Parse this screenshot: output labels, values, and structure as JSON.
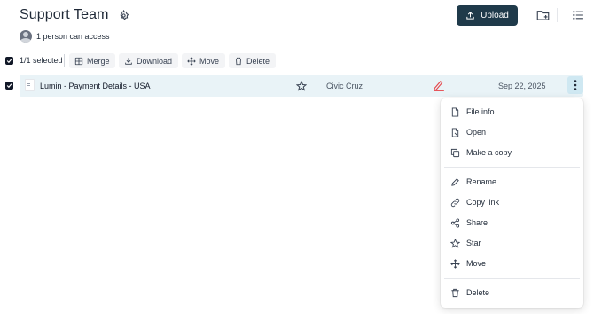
{
  "header": {
    "title": "Support Team",
    "access_text": "1 person can access",
    "upload_label": "Upload"
  },
  "toolbar": {
    "selected_count": "1/1 selected",
    "buttons": [
      {
        "label": "Merge",
        "icon": "merge-icon"
      },
      {
        "label": "Download",
        "icon": "download-icon"
      },
      {
        "label": "Move",
        "icon": "move-icon"
      },
      {
        "label": "Delete",
        "icon": "trash-icon"
      }
    ]
  },
  "files": [
    {
      "name": "Lumin - Payment Details - USA",
      "owner": "Civic Cruz",
      "date": "Sep 22, 2025",
      "selected": true,
      "status_icon": "signature-icon"
    }
  ],
  "context_menu": {
    "items": [
      {
        "label": "File info",
        "icon": "file-info-icon"
      },
      {
        "label": "Open",
        "icon": "open-file-icon"
      },
      {
        "label": "Make a copy",
        "icon": "copy-icon"
      },
      {
        "label": "Rename",
        "icon": "pencil-icon"
      },
      {
        "label": "Copy link",
        "icon": "link-icon"
      },
      {
        "label": "Share",
        "icon": "share-icon"
      },
      {
        "label": "Star",
        "icon": "star-icon"
      },
      {
        "label": "Move",
        "icon": "move-icon"
      },
      {
        "label": "Delete",
        "icon": "trash-icon"
      }
    ]
  },
  "colors": {
    "primary_button": "#1f3a4a",
    "row_selected": "#e9f3f7",
    "accent_red": "#e5484d"
  }
}
